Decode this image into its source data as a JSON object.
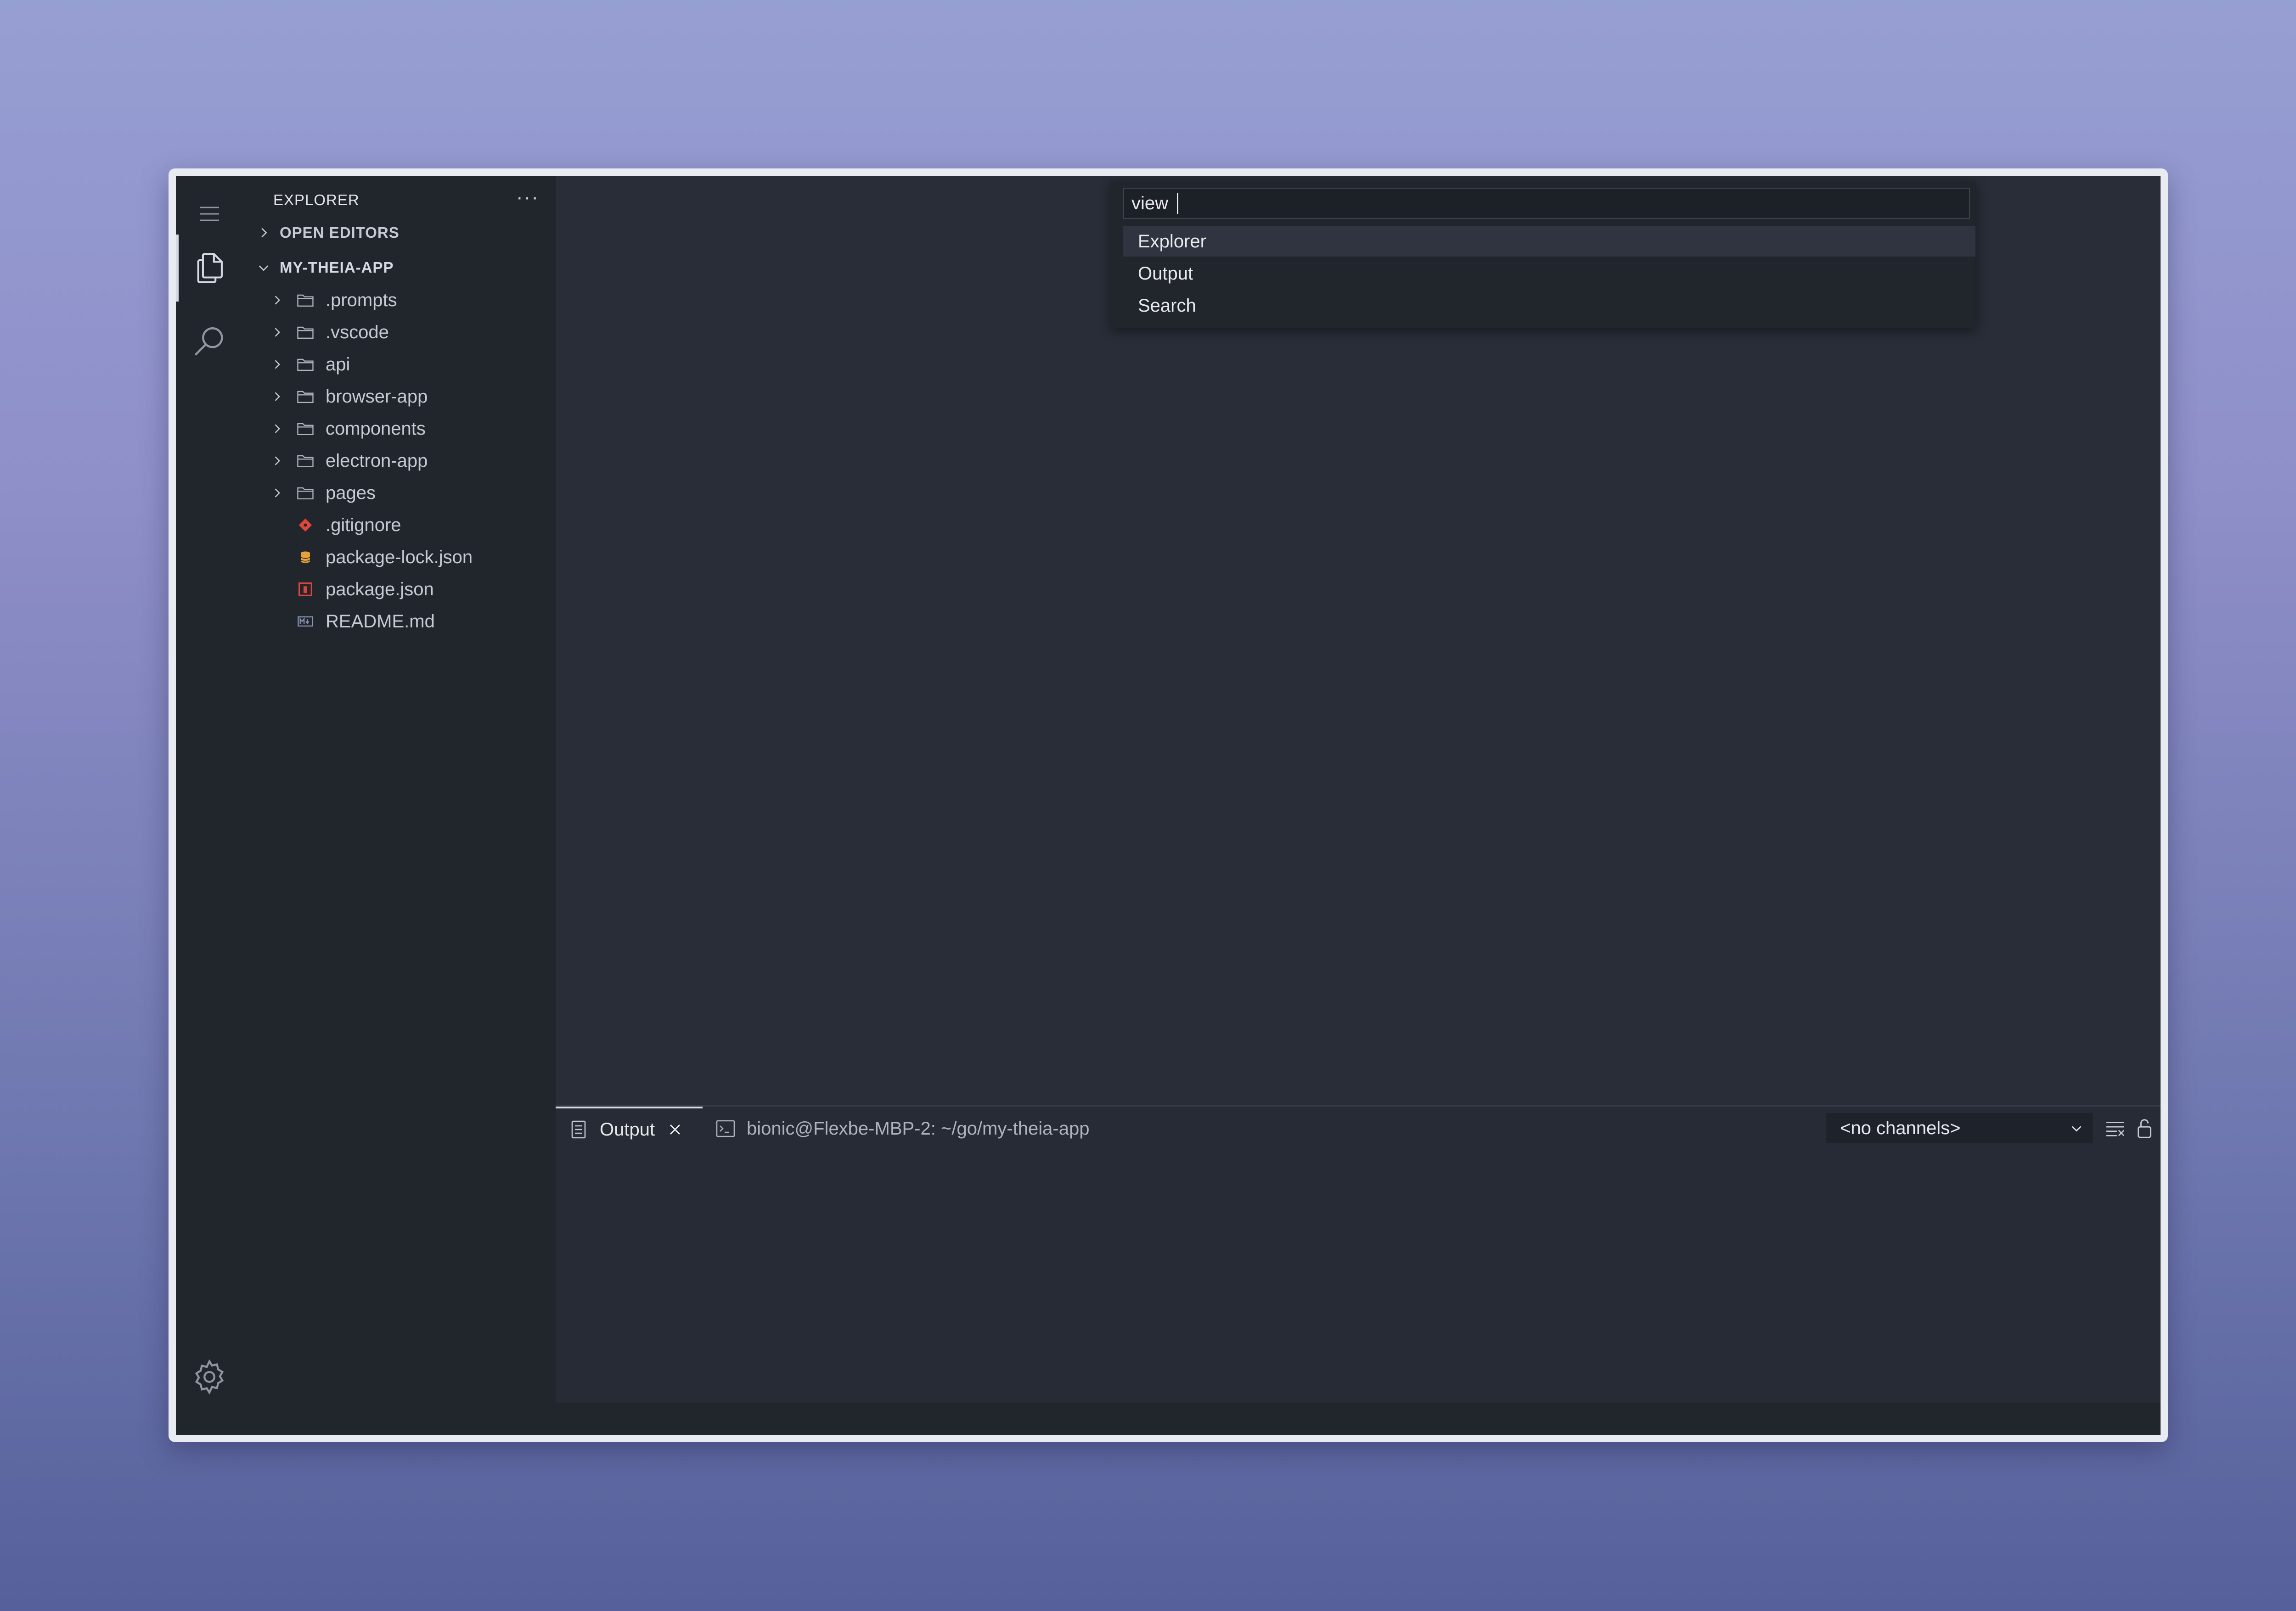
{
  "sidebar": {
    "header": "EXPLORER",
    "more_label": "···",
    "open_editors": "OPEN EDITORS",
    "project": "MY-THEIA-APP",
    "folders": [
      ".prompts",
      ".vscode",
      "api",
      "browser-app",
      "components",
      "electron-app",
      "pages"
    ],
    "files": [
      {
        "name": ".gitignore",
        "icon": "git-icon",
        "color": "#e0473b"
      },
      {
        "name": "package-lock.json",
        "icon": "database-icon",
        "color": "#e8a33b"
      },
      {
        "name": "package.json",
        "icon": "npm-icon",
        "color": "#d9453d"
      },
      {
        "name": "README.md",
        "icon": "markdown-icon",
        "color": "#8d97b5"
      }
    ]
  },
  "quick_input": {
    "value": "view ",
    "items": [
      "Explorer",
      "Output",
      "Search"
    ],
    "selected_index": 0
  },
  "panel": {
    "tabs": [
      {
        "label": "Output",
        "icon": "output-icon",
        "closable": true
      },
      {
        "label": "bionic@Flexbe-MBP-2: ~/go/my-theia-app",
        "icon": "terminal-icon",
        "closable": false
      }
    ],
    "channel_select": "<no channels>"
  },
  "colors": {
    "background_top": "#969fd2",
    "ide_background": "#262b35",
    "sidebar_background": "#21252c",
    "text": "#c6cad3"
  }
}
